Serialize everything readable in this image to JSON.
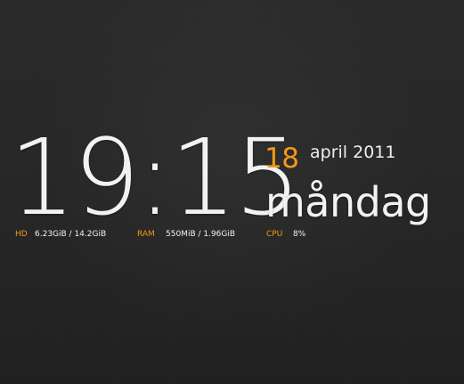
{
  "clock": {
    "time": "19:15",
    "day_number": "18",
    "month_year": "april 2011",
    "weekday": "måndag"
  },
  "stats": {
    "hd_label": "HD",
    "hd_value": "6.23GiB / 14.2GiB",
    "ram_label": "RAM",
    "ram_value": "550MiB / 1.96GiB",
    "cpu_label": "CPU",
    "cpu_value": "8%"
  },
  "colors": {
    "background": "#262626",
    "text": "#f2f2f2",
    "accent": "#f29a17"
  }
}
